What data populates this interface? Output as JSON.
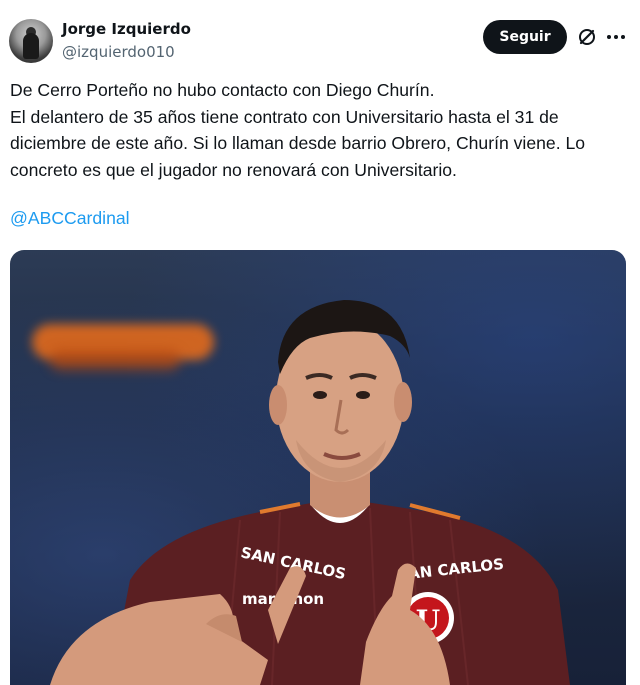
{
  "tweet": {
    "author_name": "Jorge Izquierdo",
    "author_handle": "@izquierdo010",
    "follow_label": "Seguir",
    "text_lines": [
      "De Cerro Porteño no hubo contacto con Diego Churín.",
      "El delantero de 35 años tiene contrato con Universitario hasta el 31 de",
      "diciembre de este año. Si lo llaman desde barrio Obrero, Churín viene. Lo",
      "concreto es que el jugador no renovará con Universitario."
    ],
    "mention": "@ABCCardinal"
  },
  "media": {
    "jersey_sponsor_left": "SAN CARLOS",
    "jersey_sponsor_right": "SAN CARLOS",
    "jersey_brand": "marathon",
    "crest_letter": "U"
  },
  "icons": [
    "avatar",
    "grok-icon",
    "more-icon"
  ],
  "colors": {
    "text": "#0f1419",
    "muted": "#536471",
    "link": "#1d9bf0",
    "button_bg": "#0f1419",
    "jersey": "#5b1f22"
  }
}
